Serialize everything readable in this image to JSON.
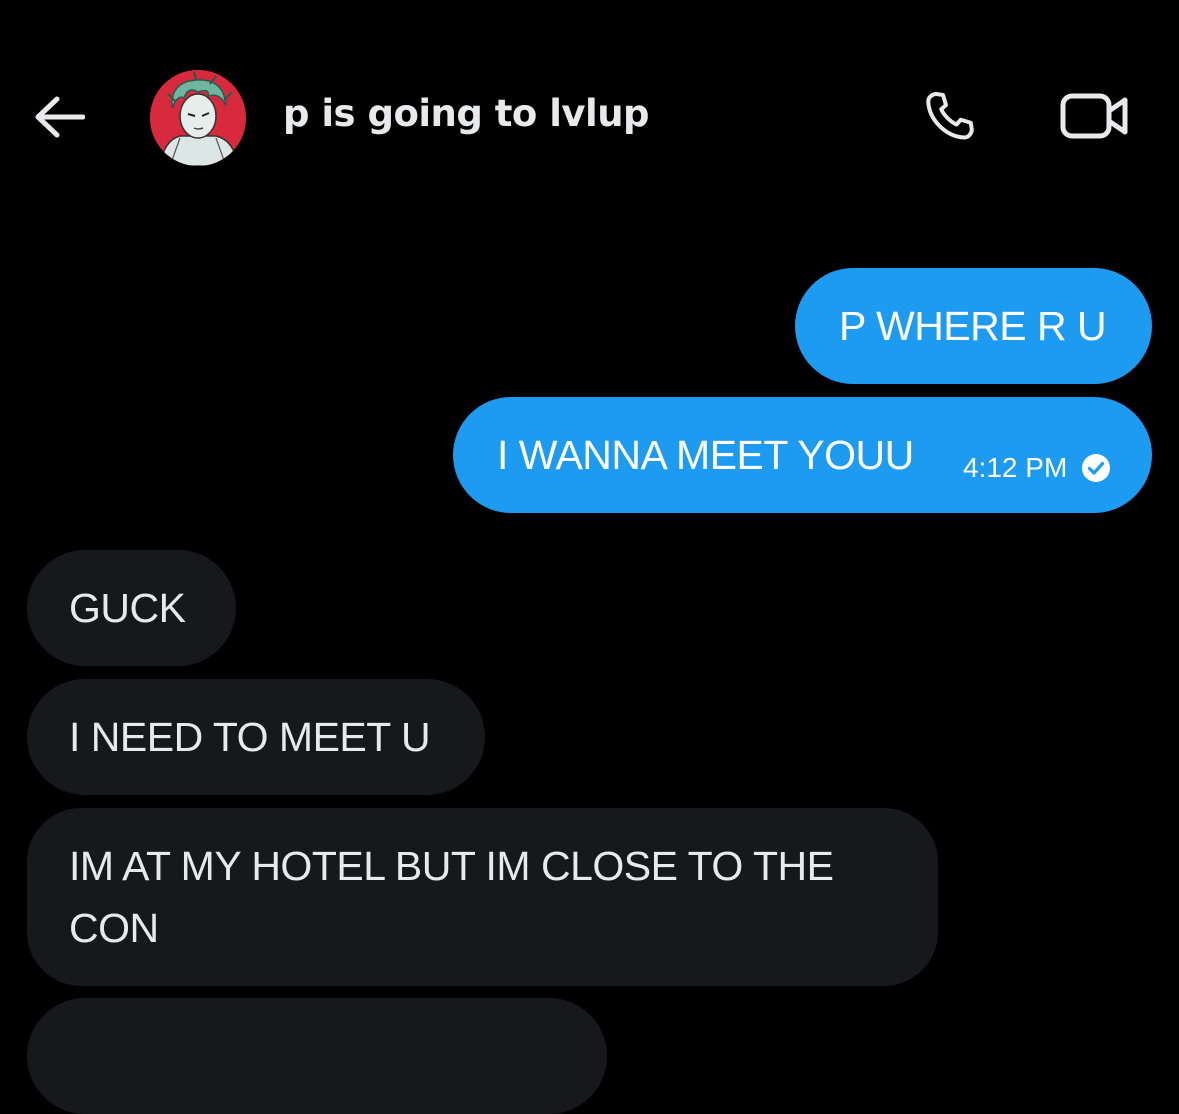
{
  "header": {
    "title": "p is going to lvlup",
    "back_icon": "arrow-left-icon",
    "call_icon": "phone-icon",
    "video_icon": "video-camera-icon"
  },
  "messages": {
    "outgoing": [
      {
        "text": "P WHERE R U"
      },
      {
        "text": "I WANNA MEET YOUU",
        "time": "4:12 PM",
        "status_icon": "check-circle-icon"
      }
    ],
    "incoming": [
      {
        "text": "GUCK"
      },
      {
        "text": "I NEED TO MEET U"
      },
      {
        "line1": "IM AT MY HOTEL BUT IM CLOSE TO THE",
        "line2": "CON"
      }
    ]
  },
  "colors": {
    "background": "#000000",
    "outgoing_bubble": "#1d9bf0",
    "incoming_bubble": "#16181c",
    "text": "#e7e9ea"
  }
}
